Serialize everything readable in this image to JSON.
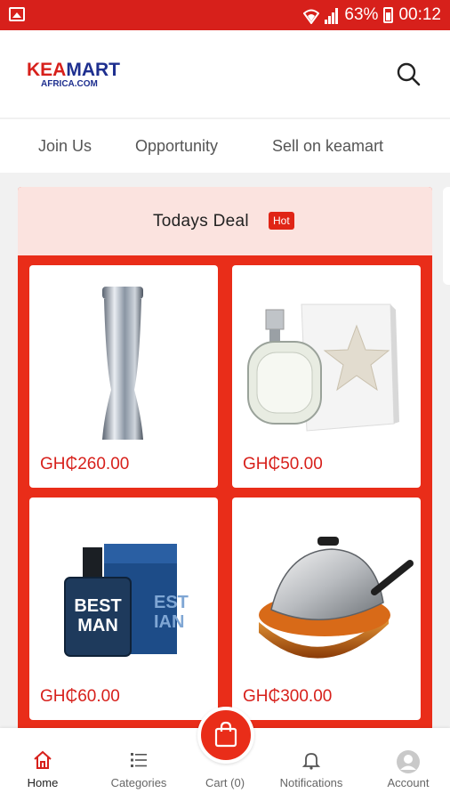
{
  "status_bar": {
    "battery": "63%",
    "time": "00:12"
  },
  "header": {
    "logo_line1_a": "KEA",
    "logo_line1_b": "M",
    "logo_line1_c": "ART",
    "logo_line2": "AFRICA.COM"
  },
  "top_nav": {
    "items": [
      {
        "label": "Join Us"
      },
      {
        "label": "Opportunity"
      },
      {
        "label": "Sell on keamart"
      }
    ]
  },
  "deal": {
    "title": "Todays Deal",
    "badge": "Hot",
    "products": [
      {
        "price": "GH₵260.00",
        "image": "vacuum-flask"
      },
      {
        "price": "GH₵50.00",
        "image": "perfume-bottle-star-box"
      },
      {
        "price": "GH₵60.00",
        "image": "best-man-cologne"
      },
      {
        "price": "GH₵300.00",
        "image": "frying-pan-with-lid"
      }
    ]
  },
  "bottom_nav": {
    "items": [
      {
        "label": "Home",
        "icon": "home-icon"
      },
      {
        "label": "Categories",
        "icon": "list-icon"
      },
      {
        "label": "Cart (0)",
        "icon": "bag-icon"
      },
      {
        "label": "Notifications",
        "icon": "bell-icon"
      },
      {
        "label": "Account",
        "icon": "avatar-icon"
      }
    ]
  },
  "colors": {
    "brand_red": "#d7201b",
    "deal_bg": "#e92d19",
    "deal_header_bg": "#fbe3df",
    "brand_blue": "#1e2f8f"
  }
}
